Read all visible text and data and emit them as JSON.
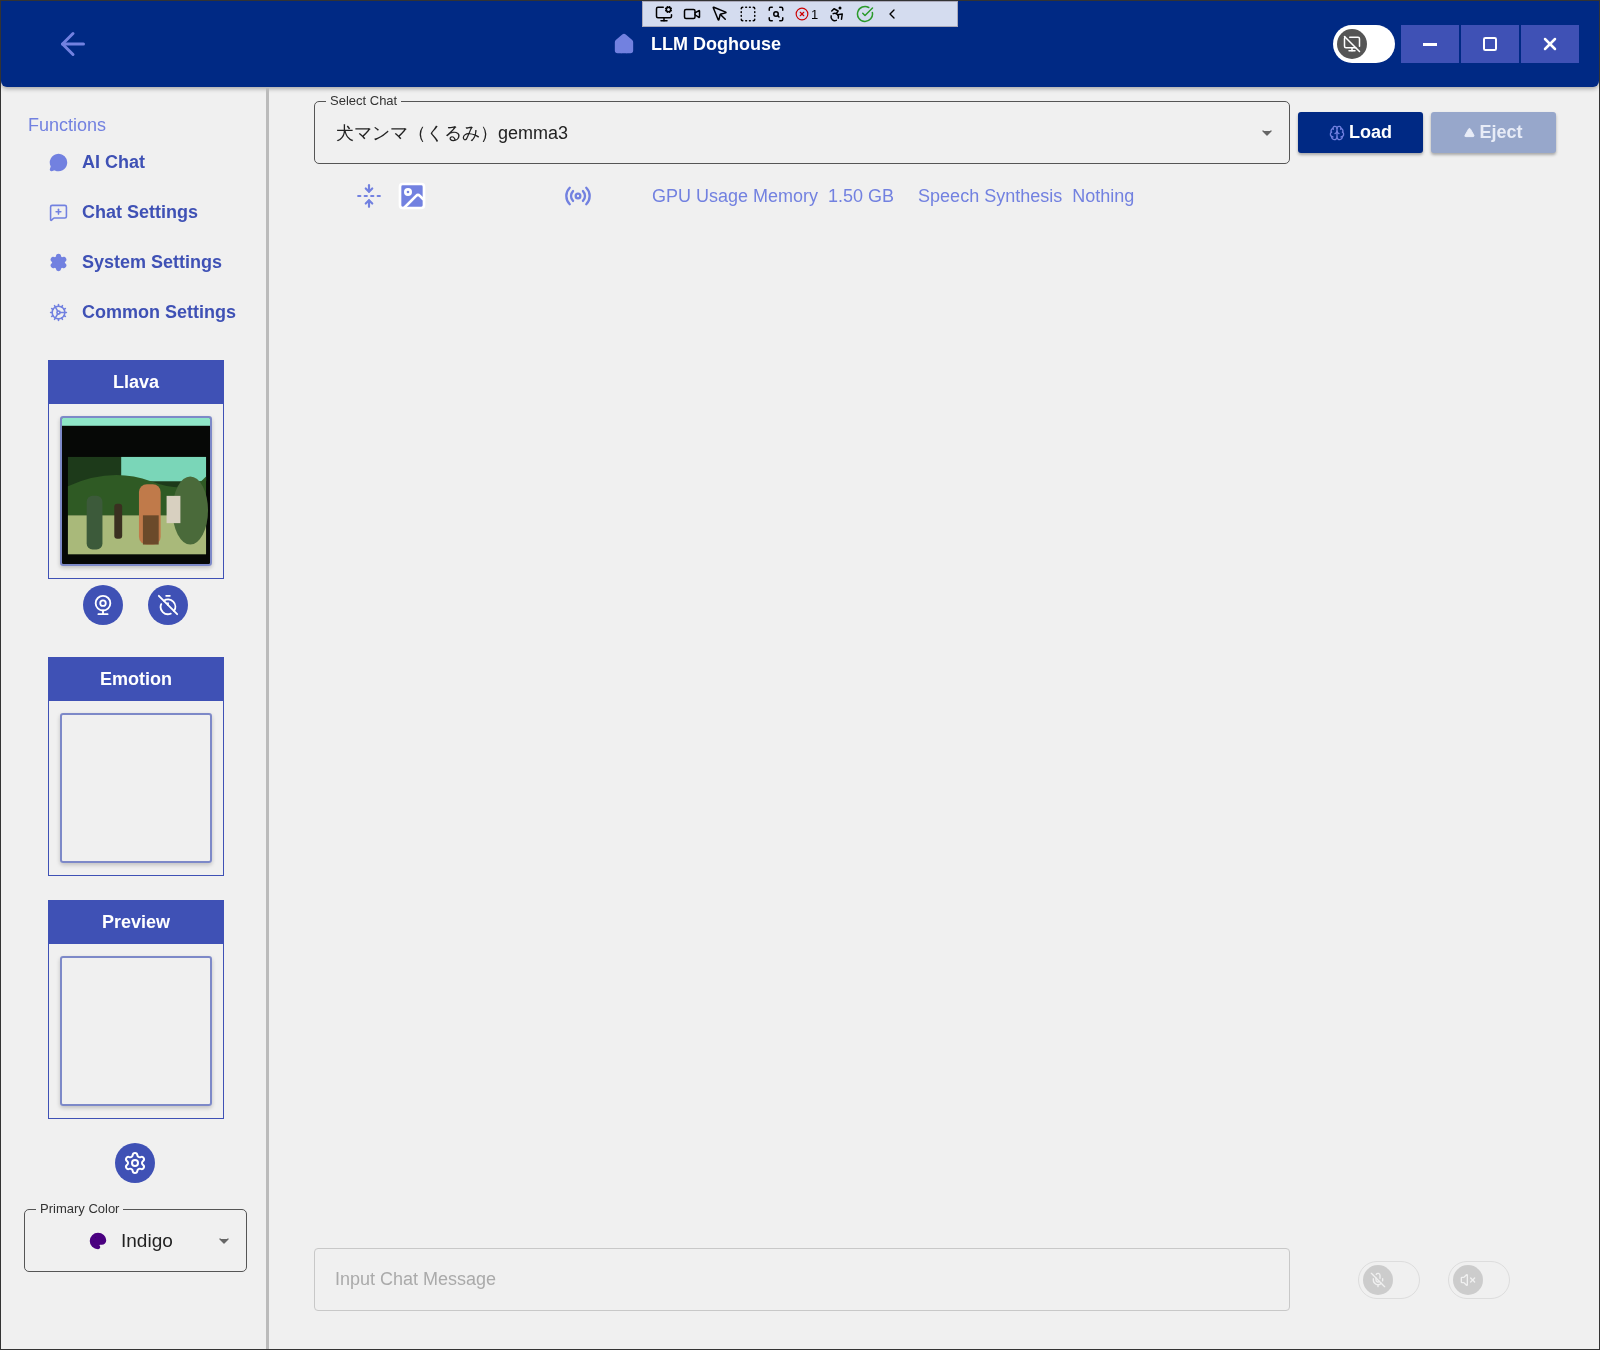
{
  "debug_toolbar": {
    "error_count": "1"
  },
  "header": {
    "title": "LLM Doghouse",
    "toggle": {
      "on": false
    }
  },
  "sidebar": {
    "heading": "Functions",
    "items": [
      {
        "label": "AI Chat",
        "kind": "chat"
      },
      {
        "label": "Chat Settings",
        "kind": "chat-add"
      },
      {
        "label": "System Settings",
        "kind": "gear"
      },
      {
        "label": "Common Settings",
        "kind": "gear-outline"
      }
    ],
    "panels": [
      {
        "title": "Llava",
        "kind": "picture"
      },
      {
        "title": "Emotion",
        "kind": "empty"
      },
      {
        "title": "Preview",
        "kind": "empty"
      }
    ],
    "primary_color": {
      "label": "Primary Color",
      "value": "Indigo"
    }
  },
  "select_chat": {
    "label": "Select Chat",
    "value": "犬マンマ（くるみ）gemma3"
  },
  "buttons": [
    {
      "label": "Load",
      "disabled": false,
      "kind": "load"
    },
    {
      "label": "Eject",
      "disabled": true,
      "kind": "eject"
    }
  ],
  "status": [
    {
      "label": "GPU Usage Memory",
      "value": "1.50 GB"
    },
    {
      "label": "Speech Synthesis",
      "value": "Nothing"
    }
  ],
  "input": {
    "placeholder": "Input Chat Message"
  },
  "bottom_toggles": [
    {
      "kind": "mic",
      "on": false,
      "disabled": true
    },
    {
      "kind": "speaker",
      "on": false,
      "disabled": true
    }
  ]
}
